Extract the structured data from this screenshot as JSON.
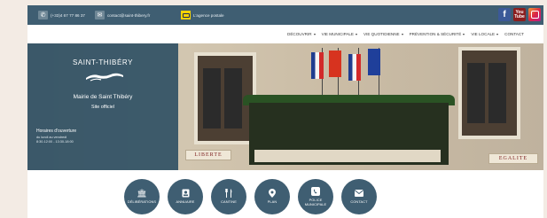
{
  "topbar": {
    "phone": "(+33)4 67 77 86 37",
    "email": "contact@saint-thibery.fr",
    "poste": "L'agence postale",
    "socials": [
      {
        "name": "facebook",
        "glyph": "f"
      },
      {
        "name": "youtube",
        "glyph": "You Tube"
      },
      {
        "name": "instagram",
        "glyph": ""
      }
    ]
  },
  "nav": {
    "items": [
      {
        "label": "DÉCOUVRIR",
        "dropdown": true
      },
      {
        "label": "VIE MUNICIPALE",
        "dropdown": true
      },
      {
        "label": "VIE QUOTIDIENNE",
        "dropdown": true
      },
      {
        "label": "PRÉVENTION & SÉCURITÉ",
        "dropdown": true
      },
      {
        "label": "VIE LOCALE",
        "dropdown": true
      },
      {
        "label": "CONTACT",
        "dropdown": false
      }
    ]
  },
  "hero": {
    "site_name": "SAINT-THIBÉRY",
    "mairie": "Mairie de Saint Thibéry",
    "officiel": "Site officiel",
    "hours_title": "Horaires d'ouverture",
    "hours_days": "du lundi au vendredi",
    "hours_times": "8:30-12:00 - 13:30-18:00",
    "sign_left": "LIBERTE",
    "sign_right": "EGALITE"
  },
  "quick_links": [
    {
      "label": "DÉLIBÉRATIONS",
      "icon": "building-icon"
    },
    {
      "label": "ANNUAIRE",
      "icon": "contact-card-icon"
    },
    {
      "label": "CANTINE",
      "icon": "cutlery-icon"
    },
    {
      "label": "PLAN",
      "icon": "map-pin-icon"
    },
    {
      "label": "POLICE MUNICIPALE",
      "icon": "phone-icon"
    },
    {
      "label": "CONTACT",
      "icon": "envelope-icon"
    }
  ],
  "colors": {
    "topbar": "#3f5e72",
    "panel": "#315265",
    "button": "#3f5e72",
    "background": "#f3ebe4"
  }
}
